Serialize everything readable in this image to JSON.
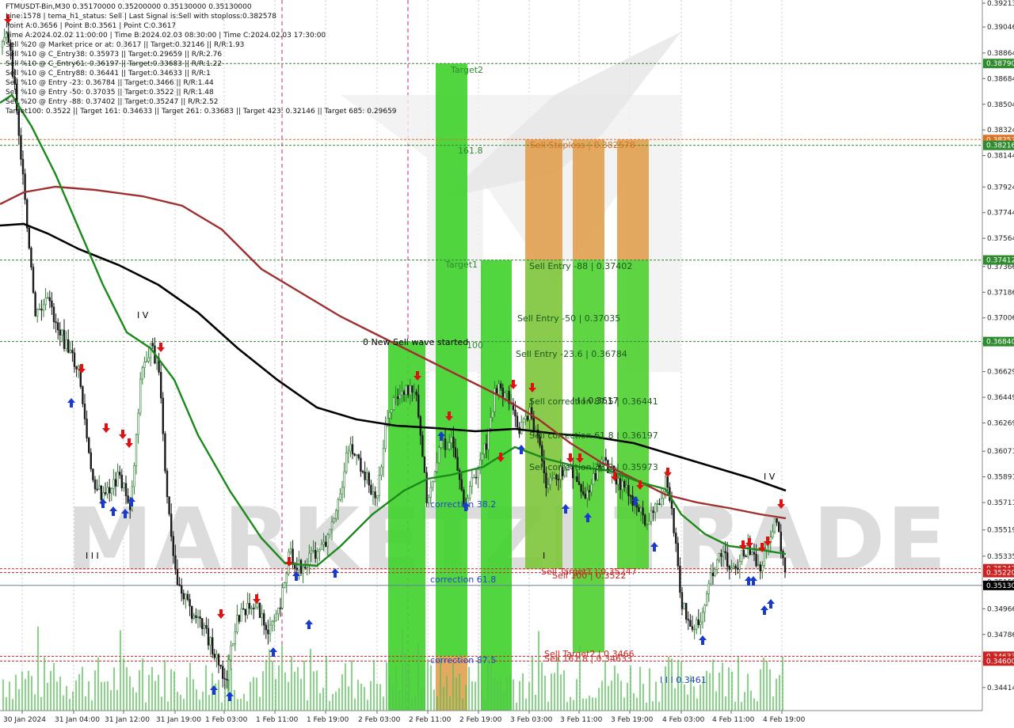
{
  "header": {
    "lines": [
      "FTMUSDT-Bin,M30  0.35170000 0.35200000 0.35130000 0.35130000",
      "Line:1578 | tema_h1_status: Sell | Last Signal is:Sell with stoploss:0.382578",
      "Point A:0.3656 | Point B:0.3561 | Point C:0.3617",
      "Time A:2024.02.02 11:00:00 | Time B:2024.02.03 08:30:00 | Time C:2024.02.03 17:30:00",
      "Sell %20 @ Market price or at: 0.3617 || Target:0.32146 || R/R:1.93",
      "Sell %10 @ C_Entry38: 0.35973 || Target:0.29659 || R/R:2.76",
      "Sell %10 @ C_Entry61: 0.36197 || Target:0.33683 || R/R:1.22",
      "Sell %10 @ C_Entry88: 0.36441 || Target:0.34633 || R/R:1",
      "Sell %10 @ Entry -23: 0.36784 || Target:0.3466 || R/R:1.44",
      "Sell %10 @ Entry -50: 0.37035 || Target:0.3522 || R/R:1.48",
      "Sell %20 @ Entry -88: 0.37402 || Target:0.35247 || R/R:2.52",
      "Target100: 0.3522 || Target 161: 0.34633 || Target 261: 0.33683 || Target 423: 0.32146 || Target 685: 0.29659"
    ]
  },
  "chart_data": {
    "type": "candlestick",
    "symbol": "FTMUSDT-Bin",
    "timeframe": "M30",
    "ohlc_last": {
      "open": 0.3517,
      "high": 0.352,
      "low": 0.3513,
      "close": 0.3513
    },
    "ylim": [
      0.3423,
      0.39213
    ],
    "y_ticks": [
      0.39213,
      0.39046,
      0.38864,
      0.38684,
      0.38504,
      0.38324,
      0.38144,
      0.37924,
      0.37744,
      0.37564,
      0.37366,
      0.37186,
      0.37006,
      0.36826,
      0.36629,
      0.36449,
      0.36269,
      0.36071,
      0.35891,
      0.35711,
      0.35519,
      0.35335,
      0.35155,
      0.34966,
      0.34786,
      0.34594,
      0.34414,
      0.3423
    ],
    "x_ticks": [
      "30 Jan 2024",
      "31 Jan 04:00",
      "31 Jan 12:00",
      "31 Jan 19:00",
      "1 Feb 03:00",
      "1 Feb 11:00",
      "1 Feb 19:00",
      "2 Feb 03:00",
      "2 Feb 11:00",
      "2 Feb 19:00",
      "3 Feb 03:00",
      "3 Feb 11:00",
      "3 Feb 19:00",
      "4 Feb 03:00",
      "4 Feb 11:00",
      "4 Feb 19:00"
    ],
    "current_price": 0.3513,
    "price_labels": [
      {
        "text": "0.38790",
        "value": 0.3879,
        "color": "#2e8b2e"
      },
      {
        "text": "0.38257",
        "value": 0.38257,
        "color": "#e07020"
      },
      {
        "text": "0.38216",
        "value": 0.38216,
        "color": "#2e8b2e"
      },
      {
        "text": "0.37412",
        "value": 0.37412,
        "color": "#2e8b2e"
      },
      {
        "text": "0.36840",
        "value": 0.3684,
        "color": "#2e8b2e"
      },
      {
        "text": "0.35247",
        "value": 0.35247,
        "color": "#cc2222"
      },
      {
        "text": "0.35220",
        "value": 0.3522,
        "color": "#cc2222"
      },
      {
        "text": "0.35130",
        "value": 0.3513,
        "color": "#000000"
      },
      {
        "text": "0.34633",
        "value": 0.34633,
        "color": "#cc2222"
      },
      {
        "text": "0.34600",
        "value": 0.346,
        "color": "#cc2222"
      }
    ],
    "h_lines": [
      {
        "value": 0.3879,
        "color": "#2e8b2e"
      },
      {
        "value": 0.38257,
        "color": "#e07020"
      },
      {
        "value": 0.38216,
        "color": "#2e8b2e"
      },
      {
        "value": 0.37412,
        "color": "#2e8b2e"
      },
      {
        "value": 0.3684,
        "color": "#2e8b2e"
      },
      {
        "value": 0.35247,
        "color": "#cc2222"
      },
      {
        "value": 0.3522,
        "color": "#cc2222"
      },
      {
        "value": 0.34633,
        "color": "#cc2222"
      },
      {
        "value": 0.346,
        "color": "#cc2222"
      }
    ],
    "annotations": [
      {
        "text": "Target2",
        "color": "#2e8b2e"
      },
      {
        "text": "161.8",
        "color": "#2e8b2e"
      },
      {
        "text": "Target1",
        "color": "#2e8b2e"
      },
      {
        "text": "100",
        "color": "#2e8b2e"
      },
      {
        "text": "0 New Sell wave started",
        "color": "#000000"
      },
      {
        "text": "Sell Stoploss | 0.382578",
        "color": "#e07020"
      },
      {
        "text": "Sell Entry -88 | 0.37402",
        "color": "#1a5a1a"
      },
      {
        "text": "Sell Entry -50 | 0.37035",
        "color": "#1a5a1a"
      },
      {
        "text": "Sell Entry -23.6 | 0.36784",
        "color": "#1a5a1a"
      },
      {
        "text": "I I I 0.3617",
        "color": "#1a1a1a"
      },
      {
        "text": "Sell correction 87.5 | 0.36441",
        "color": "#1a5a1a"
      },
      {
        "text": "Sell correction 61.8 | 0.36197",
        "color": "#1a5a1a"
      },
      {
        "text": "Sell correction 38.2 | 0.35973",
        "color": "#1a5a1a"
      },
      {
        "text": "correction 38.2",
        "color": "#2244cc"
      },
      {
        "text": "correction 61.8",
        "color": "#2244cc"
      },
      {
        "text": "correction 87.5",
        "color": "#2244cc"
      },
      {
        "text": "Sell Target1 | 0.35247",
        "color": "#cc2222"
      },
      {
        "text": "Sell 100 | 0.3522",
        "color": "#cc2222"
      },
      {
        "text": "Sell Target2 | 0.3466",
        "color": "#cc2222"
      },
      {
        "text": "Sell 161.8 | 0.34633",
        "color": "#cc2222"
      },
      {
        "text": "I I I 0.3461",
        "color": "#2244cc"
      },
      {
        "text": "I V",
        "color": "#000000"
      },
      {
        "text": "I V",
        "color": "#000000"
      },
      {
        "text": "I I I",
        "color": "#000000"
      },
      {
        "text": "I",
        "color": "#000000"
      }
    ],
    "watermark": "MARKETZI TRADE",
    "colors": {
      "bull": "#2e7d32",
      "bear": "#1a1a1a",
      "ma_fast": "#1a8a1a",
      "ma_mid": "#a03030",
      "ma_slow": "#000000",
      "zone_green": "#3fd22a",
      "zone_orange": "#e0a050"
    }
  }
}
